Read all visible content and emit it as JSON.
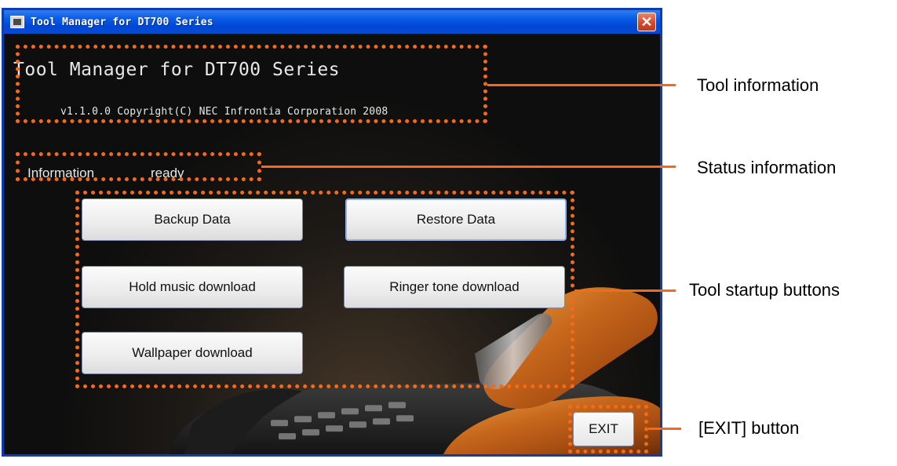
{
  "window": {
    "title": "Tool Manager for DT700 Series",
    "close_glyph": "✕"
  },
  "tool_info": {
    "name": "Tool Manager for DT700 Series",
    "copyright": "v1.1.0.0 Copyright(C) NEC Infrontia Corporation 2008"
  },
  "status": {
    "label": "Information",
    "value": "ready"
  },
  "buttons": {
    "backup": "Backup Data",
    "restore": "Restore Data",
    "hold_music": "Hold music download",
    "ringer_tone": "Ringer tone download",
    "wallpaper": "Wallpaper download",
    "exit": "EXIT"
  },
  "callouts": {
    "tool_information": "Tool information",
    "status_information": "Status information",
    "tool_startup_buttons": "Tool startup buttons",
    "exit_button": "[EXIT] button"
  },
  "colors": {
    "highlight": "#f26b1c",
    "titlebar": "#0a5ce6",
    "window_bg": "#0d0d0d"
  }
}
